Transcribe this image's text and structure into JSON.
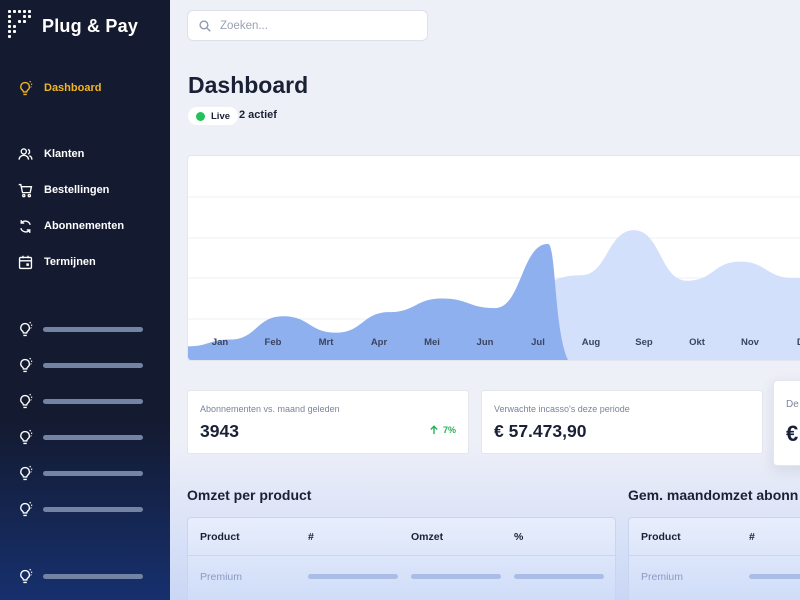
{
  "app": {
    "name": "Plug & Pay"
  },
  "sidebar": {
    "items": [
      {
        "label": "Dashboard",
        "icon": "lightbulb-icon",
        "active": true
      },
      {
        "label": "Klanten",
        "icon": "users-icon"
      },
      {
        "label": "Bestellingen",
        "icon": "cart-icon"
      },
      {
        "label": "Abonnementen",
        "icon": "refresh-icon"
      },
      {
        "label": "Termijnen",
        "icon": "calendar-icon"
      }
    ],
    "placeholder_icon": "lightbulb-icon"
  },
  "search": {
    "placeholder": "Zoeken..."
  },
  "page": {
    "title": "Dashboard",
    "live_label": "Live",
    "active_text": "2 actief"
  },
  "chart_data": {
    "type": "area",
    "categories": [
      "Jan",
      "Feb",
      "Mrt",
      "Apr",
      "Mei",
      "Jun",
      "Jul",
      "Aug",
      "Sep",
      "Okt",
      "Nov",
      "Dec"
    ],
    "x_labels": [
      "Jan",
      "Feb",
      "Mrt",
      "Apr",
      "Mei",
      "Jun",
      "Jul",
      "Aug",
      "Sep",
      "Okt",
      "Nov",
      "De"
    ],
    "series": [
      {
        "values": [
          0.15,
          0.32,
          0.2,
          0.35,
          0.45,
          0.38,
          0.85,
          null,
          null,
          null,
          null,
          null
        ],
        "color": "#8fb0ee"
      },
      {
        "values": [
          null,
          null,
          null,
          null,
          null,
          null,
          0.55,
          0.62,
          0.95,
          0.58,
          0.72,
          0.6
        ],
        "color": "#d3e0fb"
      }
    ],
    "ylim": [
      0,
      1.2
    ],
    "grid": true
  },
  "stats": [
    {
      "label": "Abonnementen vs. maand geleden",
      "value": "3943",
      "trend": "7%",
      "trend_icon": "arrow-up-icon"
    },
    {
      "label": "Verwachte incasso's deze periode",
      "value": "€ 57.473,90"
    },
    {
      "label": "De",
      "value": "€"
    }
  ],
  "tables": [
    {
      "title": "Omzet per product",
      "headers": [
        "Product",
        "#",
        "Omzet",
        "%"
      ],
      "rows": [
        {
          "product": "Premium"
        }
      ]
    },
    {
      "title": "Gem. maandomzet abonn",
      "headers": [
        "Product",
        "#"
      ],
      "rows": [
        {
          "product": "Premium"
        }
      ]
    }
  ]
}
